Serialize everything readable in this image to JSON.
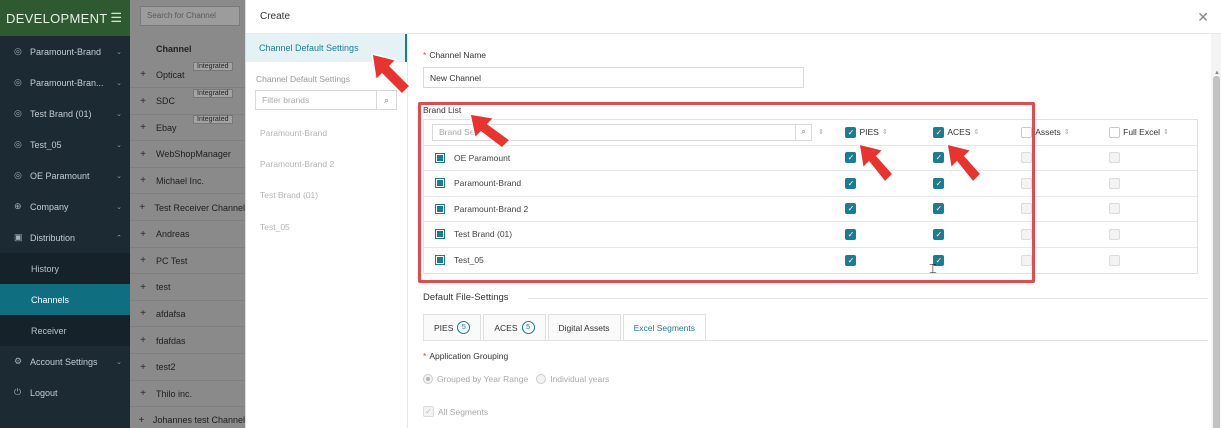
{
  "sidebar": {
    "title": "DEVELOPMENT",
    "items": [
      {
        "label": "Paramount-Brand",
        "icon": "brand-icon"
      },
      {
        "label": "Paramount-Bran...",
        "icon": "brand-icon"
      },
      {
        "label": "Test Brand (01)",
        "icon": "brand-icon"
      },
      {
        "label": "Test_05",
        "icon": "brand-icon"
      },
      {
        "label": "OE Paramount",
        "icon": "brand-icon"
      },
      {
        "label": "Company",
        "icon": "globe-icon"
      },
      {
        "label": "Distribution",
        "icon": "calendar-icon"
      }
    ],
    "subitems": [
      "History",
      "Channels",
      "Receiver"
    ],
    "bottom": [
      {
        "label": "Account Settings",
        "icon": "gear-icon"
      },
      {
        "label": "Logout",
        "icon": "power-icon"
      }
    ]
  },
  "background": {
    "search_placeholder": "Search for Channel",
    "header": "Channel",
    "channels": [
      {
        "name": "Opticat",
        "tag": "Integrated"
      },
      {
        "name": "SDC",
        "tag": "Integrated"
      },
      {
        "name": "Ebay",
        "tag": "Integrated"
      },
      {
        "name": "WebShopManager",
        "tag": ""
      },
      {
        "name": "Michael Inc.",
        "tag": ""
      },
      {
        "name": "Test Receiver Channel",
        "tag": ""
      },
      {
        "name": "Andreas",
        "tag": ""
      },
      {
        "name": "PC Test",
        "tag": ""
      },
      {
        "name": "test",
        "tag": ""
      },
      {
        "name": "afdafsa",
        "tag": ""
      },
      {
        "name": "fdafdas",
        "tag": ""
      },
      {
        "name": "test2",
        "tag": ""
      },
      {
        "name": "Thilo inc.",
        "tag": ""
      },
      {
        "name": "Johannes test Channel",
        "tag": ""
      }
    ]
  },
  "modal": {
    "title": "Create",
    "left": {
      "active_tab": "Channel Default Settings",
      "subtitle": "Channel Default Settings",
      "filter_placeholder": "Filter brands",
      "brands": [
        "Paramount-Brand",
        "Paramount-Brand 2",
        "Test Brand (01)",
        "Test_05"
      ]
    },
    "channel_name_label": "Channel Name",
    "channel_name_value": "New Channel",
    "brand_list_label": "Brand List",
    "brand_search_placeholder": "Brand Se",
    "columns": [
      "PIES",
      "ACES",
      "Assets",
      "Full Excel"
    ],
    "header_checked": [
      true,
      true,
      false,
      false
    ],
    "rows": [
      {
        "name": "OE Paramount",
        "pies": true,
        "aces": true,
        "assets": false,
        "full": false
      },
      {
        "name": "Paramount-Brand",
        "pies": true,
        "aces": true,
        "assets": false,
        "full": false
      },
      {
        "name": "Paramount-Brand 2",
        "pies": true,
        "aces": true,
        "assets": false,
        "full": false
      },
      {
        "name": "Test Brand (01)",
        "pies": true,
        "aces": true,
        "assets": false,
        "full": false
      },
      {
        "name": "Test_05",
        "pies": true,
        "aces": true,
        "assets": false,
        "full": false
      }
    ],
    "file_settings_title": "Default File-Settings",
    "tabs": [
      {
        "label": "PIES",
        "count": "5"
      },
      {
        "label": "ACES",
        "count": "5"
      },
      {
        "label": "Digital Assets",
        "count": ""
      },
      {
        "label": "Excel Segments",
        "count": ""
      }
    ],
    "application_grouping_label": "Application Grouping",
    "grouping_options": [
      "Grouped by Year Range",
      "Individual years"
    ],
    "all_segments_label": "All Segments"
  },
  "colors": {
    "accent": "#1a7d91",
    "highlight": "#e5484d",
    "required": "#e0433b"
  }
}
